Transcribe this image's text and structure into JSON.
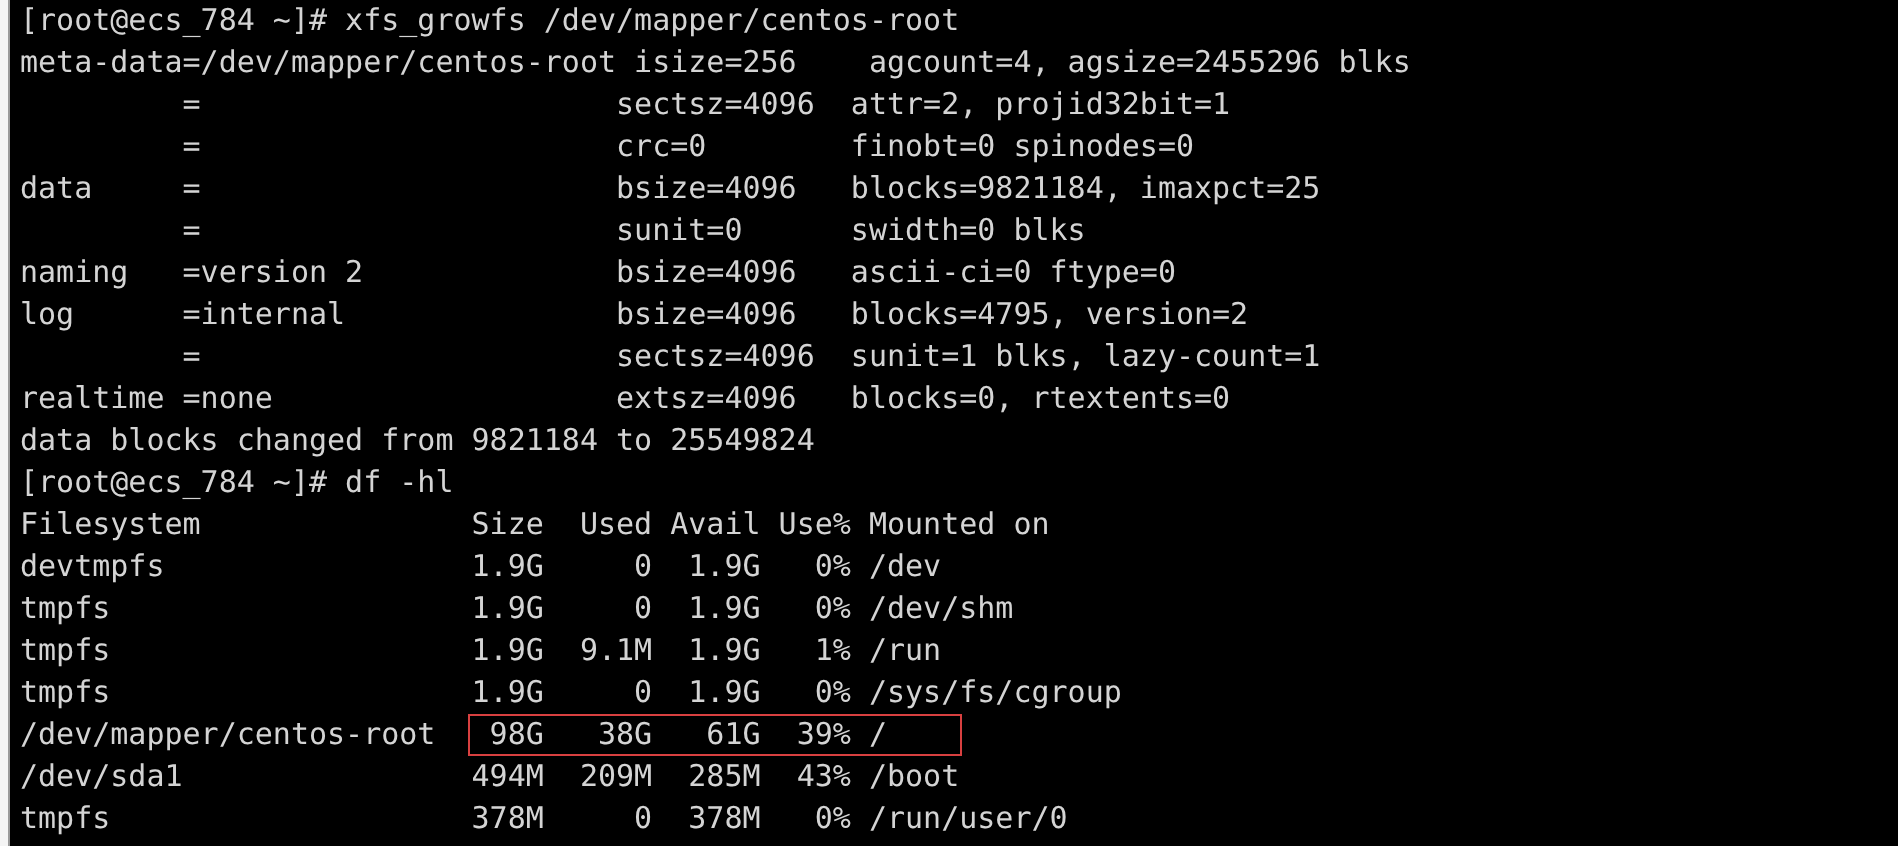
{
  "terminal": {
    "lines": [
      {
        "text": "[root@ecs_784 ~]# xfs_growfs /dev/mapper/centos-root"
      },
      {
        "text": "meta-data=/dev/mapper/centos-root isize=256    agcount=4, agsize=2455296 blks"
      },
      {
        "text": "         =                       sectsz=4096  attr=2, projid32bit=1"
      },
      {
        "text": "         =                       crc=0        finobt=0 spinodes=0"
      },
      {
        "text": "data     =                       bsize=4096   blocks=9821184, imaxpct=25"
      },
      {
        "text": "         =                       sunit=0      swidth=0 blks"
      },
      {
        "text": "naming   =version 2              bsize=4096   ascii-ci=0 ftype=0"
      },
      {
        "text": "log      =internal               bsize=4096   blocks=4795, version=2"
      },
      {
        "text": "         =                       sectsz=4096  sunit=1 blks, lazy-count=1"
      },
      {
        "text": "realtime =none                   extsz=4096   blocks=0, rtextents=0"
      },
      {
        "text": "data blocks changed from 9821184 to 25549824"
      },
      {
        "text": "[root@ecs_784 ~]# df -hl"
      },
      {
        "text": "Filesystem               Size  Used Avail Use% Mounted on"
      },
      {
        "text": "devtmpfs                 1.9G     0  1.9G   0% /dev"
      },
      {
        "text": "tmpfs                    1.9G     0  1.9G   0% /dev/shm"
      },
      {
        "text": "tmpfs                    1.9G  9.1M  1.9G   1% /run"
      },
      {
        "text": "tmpfs                    1.9G     0  1.9G   0% /sys/fs/cgroup"
      },
      {
        "text": "/dev/mapper/centos-root  ",
        "boxed": " 98G   38G   61G  39% /"
      },
      {
        "text": "/dev/sda1                494M  209M  285M  43% /boot"
      },
      {
        "text": "tmpfs                    378M     0  378M   0% /run/user/0"
      }
    ]
  }
}
